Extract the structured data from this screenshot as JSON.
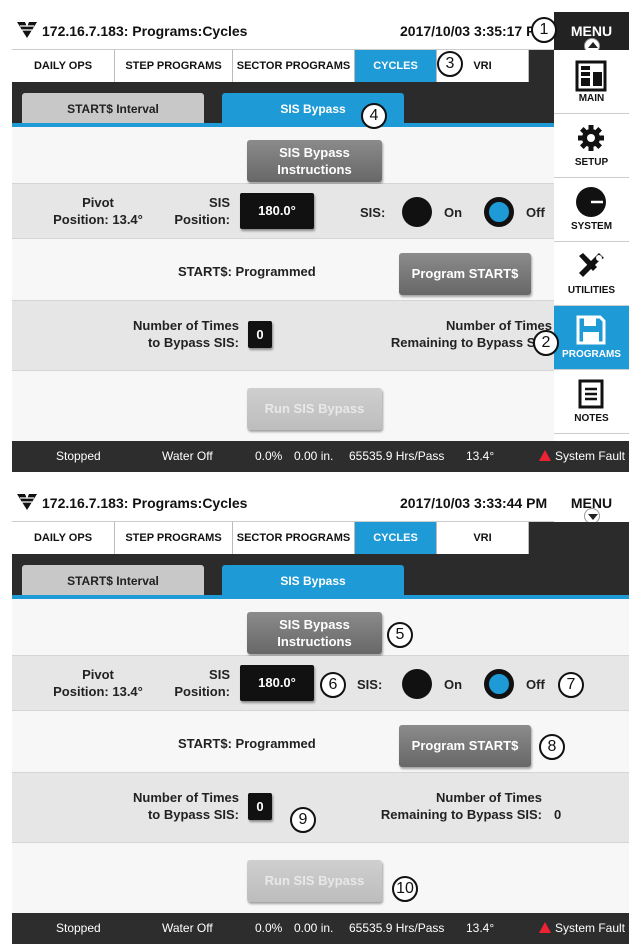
{
  "app": {
    "title": "172.16.7.183: Programs:Cycles",
    "menu_label": "MENU",
    "colors": {
      "accent": "#1e9ad6",
      "dark": "#2b2b2b",
      "fault": "#e22233"
    }
  },
  "screens": [
    {
      "datetime": "2017/10/03 3:35:17 PM",
      "menu_open": true,
      "callouts": [
        "1",
        "2",
        "3",
        "4"
      ]
    },
    {
      "datetime": "2017/10/03 3:33:44 PM",
      "menu_open": false,
      "callouts": [
        "5",
        "6",
        "7",
        "8",
        "9",
        "10"
      ]
    }
  ],
  "tabs": [
    "DAILY OPS",
    "STEP PROGRAMS",
    "SECTOR PROGRAMS",
    "CYCLES",
    "VRI"
  ],
  "active_tab": "CYCLES",
  "subtabs": [
    "START$ Interval",
    "SIS Bypass"
  ],
  "active_subtab": "SIS Bypass",
  "instructions_button": {
    "line1": "SIS Bypass",
    "line2": "Instructions"
  },
  "pivot": {
    "label1": "Pivot",
    "label2": "Position: 13.4°"
  },
  "sis_position": {
    "label1": "SIS",
    "label2": "Position:",
    "value": "180.0°"
  },
  "sis": {
    "label": "SIS:",
    "on_label": "On",
    "off_label": "Off",
    "selected": "Off"
  },
  "start": {
    "status_text": "START$: Programmed",
    "button": "Program START$"
  },
  "bypass": {
    "times_label1": "Number of Times",
    "times_label2": "to Bypass SIS:",
    "times_value": "0",
    "remaining_label1": "Number of Times",
    "remaining_label2": "Remaining to Bypass SIS:",
    "remaining_value": "0"
  },
  "run_button": "Run SIS Bypass",
  "status": {
    "state": "Stopped",
    "water": "Water Off",
    "percent": "0.0%",
    "depth": "0.00 in.",
    "hours": "65535.9 Hrs/Pass",
    "angle": "13.4°",
    "fault": "System Fault"
  },
  "side_menu": [
    {
      "label": "MAIN",
      "icon": "main-screen-icon"
    },
    {
      "label": "SETUP",
      "icon": "gear-icon"
    },
    {
      "label": "SYSTEM",
      "icon": "system-gauge-icon"
    },
    {
      "label": "UTILITIES",
      "icon": "tools-icon"
    },
    {
      "label": "PROGRAMS",
      "icon": "floppy-disk-icon",
      "active": true
    },
    {
      "label": "NOTES",
      "icon": "notes-icon"
    }
  ]
}
